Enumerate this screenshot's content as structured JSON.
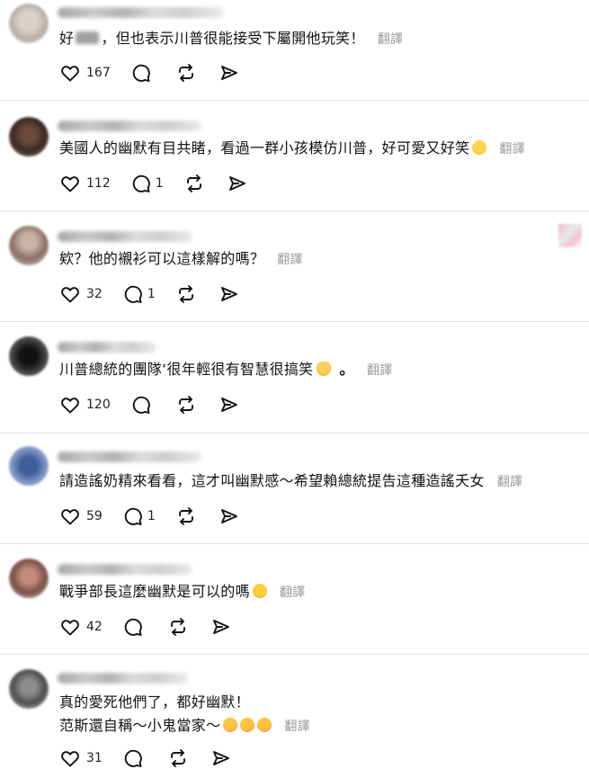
{
  "translate_label": "翻譯",
  "comments": [
    {
      "parts": [
        "好",
        "，但也表示川普很能接受下屬開他玩笑！"
      ],
      "likes": "167",
      "replies": ""
    },
    {
      "text": "美國人的幽默有目共睹，看過一群小孩模仿川普，好可愛又好笑",
      "emoji": "laugh-emoji",
      "likes": "112",
      "replies": "1"
    },
    {
      "text": "欸？他的襯衫可以這樣解的嗎？",
      "likes": "32",
      "replies": "1"
    },
    {
      "text": "川普總統的團隊‘很年輕很有智慧很搞笑",
      "emoji": "folded-hands-emoji",
      "trail": "。",
      "likes": "120",
      "replies": ""
    },
    {
      "text": "請造謠奶精來看看，這才叫幽默感～希望賴總統提告這種造謠夭女",
      "likes": "59",
      "replies": "1"
    },
    {
      "text": "戰爭部長這麼幽默是可以的嗎",
      "emoji": "zany-face-emoji",
      "likes": "42",
      "replies": ""
    },
    {
      "line1": "真的愛死他們了，都好幽默！",
      "line2": "范斯還自稱～小鬼當家～",
      "emoji": "kiss-emoji",
      "likes": "31",
      "replies": ""
    }
  ],
  "colors": {
    "divider": "#e2e2e2",
    "secondary_text": "#999999",
    "icon": "#111111"
  }
}
